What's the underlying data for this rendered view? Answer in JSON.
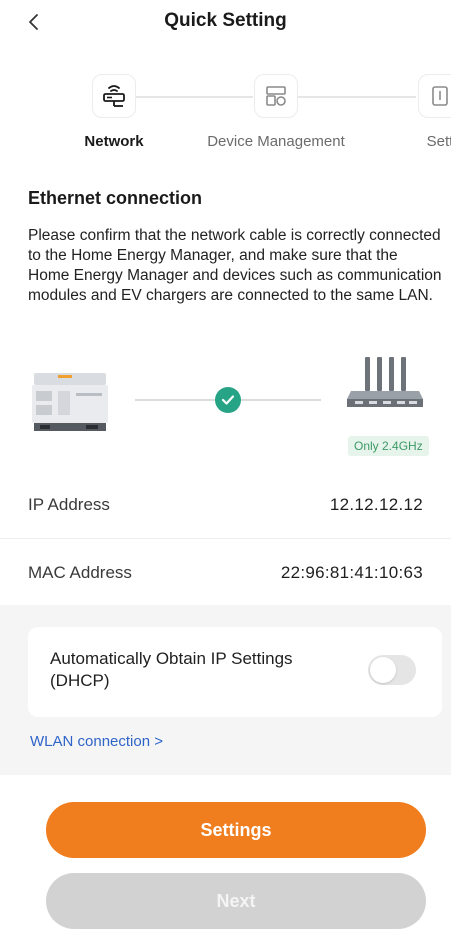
{
  "header": {
    "title": "Quick Setting",
    "back_icon": "chevron-left-icon"
  },
  "steps": [
    {
      "label": "Network",
      "icon": "router-icon",
      "active": true
    },
    {
      "label": "Device Management",
      "icon": "device-management-icon",
      "active": false
    },
    {
      "label": "Sett",
      "icon": "settings-icon",
      "active": false
    }
  ],
  "section": {
    "title": "Ethernet connection",
    "description": "Please confirm that the network cable is correctly connected to the Home Energy Manager, and make sure that the Home Energy Manager and devices such as communication modules and EV chargers are connected to the same LAN."
  },
  "illustration": {
    "status_icon": "check-icon",
    "band_badge": "Only 2.4GHz"
  },
  "info": {
    "ip_label": "IP Address",
    "ip_value": "12.12.12.12",
    "mac_label": "MAC Address",
    "mac_value": "22:96:81:41:10:63"
  },
  "dhcp": {
    "label": "Automatically Obtain IP Settings (DHCP)",
    "enabled": false
  },
  "wlan_link": "WLAN connection >",
  "buttons": {
    "settings": "Settings",
    "next": "Next"
  },
  "colors": {
    "accent": "#f07d1e",
    "success": "#27a386",
    "link": "#2f64c9",
    "disabled": "#d2d2d2"
  }
}
